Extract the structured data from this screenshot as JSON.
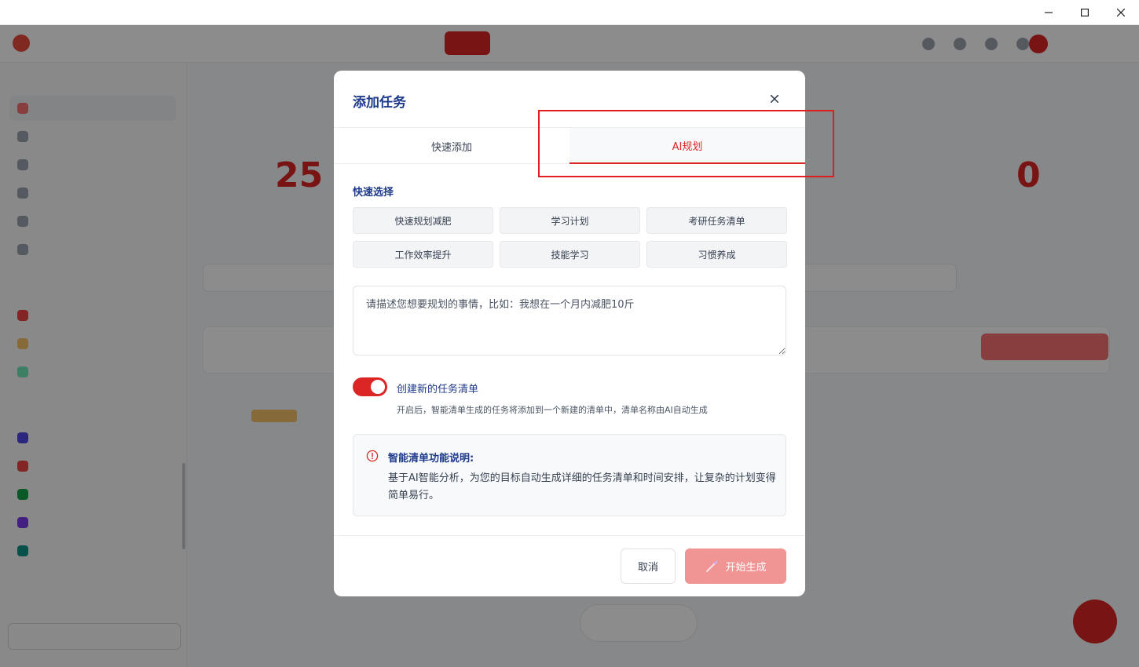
{
  "window": {
    "minimize_glyph": "–",
    "maximize_glyph": "□",
    "close_glyph": "✕"
  },
  "modal": {
    "title": "添加任务",
    "tabs": [
      {
        "label": "快速添加",
        "active": false
      },
      {
        "label": "AI规划",
        "active": true
      }
    ],
    "quick_select": {
      "label": "快速选择",
      "options": [
        "快速规划减肥",
        "学习计划",
        "考研任务清单",
        "工作效率提升",
        "技能学习",
        "习惯养成"
      ]
    },
    "description": {
      "value": "",
      "placeholder": "请描述您想要规划的事情，比如：我想在一个月内减肥10斤"
    },
    "create_list_toggle": {
      "on": true,
      "label": "创建新的任务清单",
      "hint": "开启后，智能清单生成的任务将添加到一个新建的清单中，清单名称由AI自动生成"
    },
    "info": {
      "title": "智能清单功能说明:",
      "body": "基于AI智能分析，为您的目标自动生成详细的任务清单和时间安排，让复杂的计划变得简单易行。"
    },
    "buttons": {
      "cancel": "取消",
      "start": "开始生成"
    }
  },
  "background": {
    "stat_left": "25",
    "stat_right": "0"
  },
  "colors": {
    "accent": "#dc2626",
    "title": "#1e3a8a",
    "start_disabled": "#f09494",
    "annotation": "#e11d1d"
  }
}
